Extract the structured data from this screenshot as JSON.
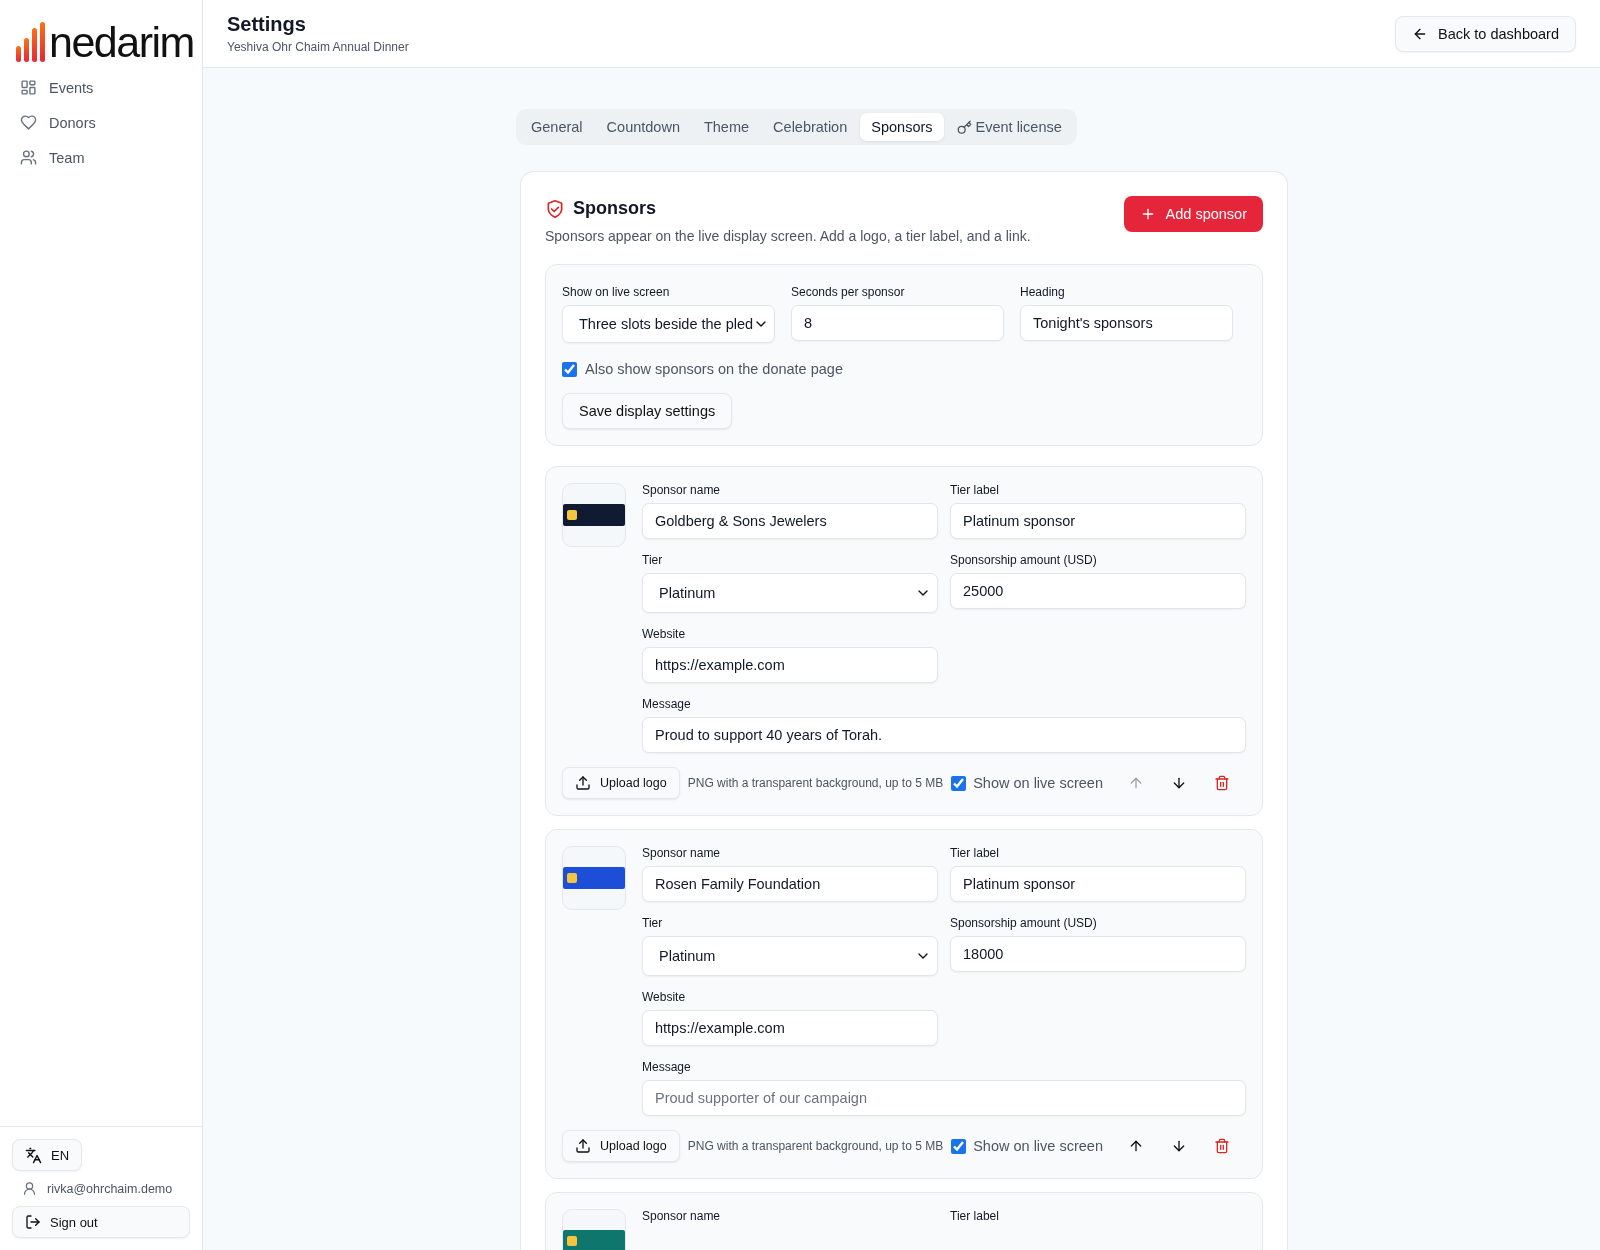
{
  "brand": {
    "name": "nedarim"
  },
  "sidebar": {
    "items": [
      {
        "label": "Events",
        "kind": "grid"
      },
      {
        "label": "Donors",
        "kind": "heart"
      },
      {
        "label": "Team",
        "kind": "users"
      }
    ],
    "language": "EN",
    "user_email": "rivka@ohrchaim.demo",
    "sign_out": "Sign out"
  },
  "header": {
    "title": "Settings",
    "subtitle": "Yeshiva Ohr Chaim Annual Dinner",
    "back_button": "Back to dashboard"
  },
  "tabs": [
    {
      "label": "General",
      "selected": false
    },
    {
      "label": "Countdown",
      "selected": false
    },
    {
      "label": "Theme",
      "selected": false
    },
    {
      "label": "Celebration",
      "selected": false
    },
    {
      "label": "Sponsors",
      "selected": true
    },
    {
      "label": "Event license",
      "selected": false,
      "kind": "key"
    }
  ],
  "panel": {
    "title": "Sponsors",
    "description": "Sponsors appear on the live display screen. Add a logo, a tier label, and a link.",
    "add_button": "Add sponsor",
    "display_settings": {
      "fields": [
        {
          "label": "Show on live screen",
          "kind": "select",
          "value": "Three slots beside the pled"
        },
        {
          "label": "Seconds per sponsor",
          "kind": "text",
          "value": "8"
        },
        {
          "label": "Heading",
          "kind": "text",
          "value": "Tonight's sponsors"
        }
      ],
      "donate_page": {
        "label": "Also show sponsors on the donate page",
        "checked": true
      },
      "save_button": "Save display settings"
    }
  },
  "sponsors": [
    {
      "color": "#111a33",
      "fields": [
        {
          "label": "Sponsor name",
          "kind": "text",
          "value": "Goldberg & Sons Jewelers"
        },
        {
          "label": "Tier label",
          "kind": "text",
          "value": "Platinum sponsor"
        },
        {
          "label": "Tier",
          "kind": "select",
          "value": "Platinum"
        },
        {
          "label": "Sponsorship amount (USD)",
          "kind": "text",
          "value": "25000"
        },
        {
          "label": "Website",
          "kind": "text",
          "value": "https://example.com"
        },
        {
          "label": "Message",
          "kind": "wide",
          "value": "Proud to support 40 years of Torah."
        }
      ],
      "upload_button": "Upload logo",
      "upload_hint": "PNG with a transparent background, up to 5 MB",
      "show_on_live": {
        "label": "Show on live screen",
        "checked": true
      },
      "can_move_up": false
    },
    {
      "color": "#1d4ed8",
      "fields": [
        {
          "label": "Sponsor name",
          "kind": "text",
          "value": "Rosen Family Foundation"
        },
        {
          "label": "Tier label",
          "kind": "text",
          "value": "Platinum sponsor"
        },
        {
          "label": "Tier",
          "kind": "select",
          "value": "Platinum"
        },
        {
          "label": "Sponsorship amount (USD)",
          "kind": "text",
          "value": "18000"
        },
        {
          "label": "Website",
          "kind": "text",
          "value": "https://example.com"
        },
        {
          "label": "Message",
          "kind": "wide",
          "placeholder": "Proud supporter of our campaign"
        }
      ],
      "upload_button": "Upload logo",
      "upload_hint": "PNG with a transparent background, up to 5 MB",
      "show_on_live": {
        "label": "Show on live screen",
        "checked": true
      },
      "can_move_up": true
    },
    {
      "color": "#0f766e",
      "fields": [
        {
          "label": "Sponsor name",
          "kind": "text"
        },
        {
          "label": "Tier label",
          "kind": "text"
        }
      ]
    }
  ]
}
